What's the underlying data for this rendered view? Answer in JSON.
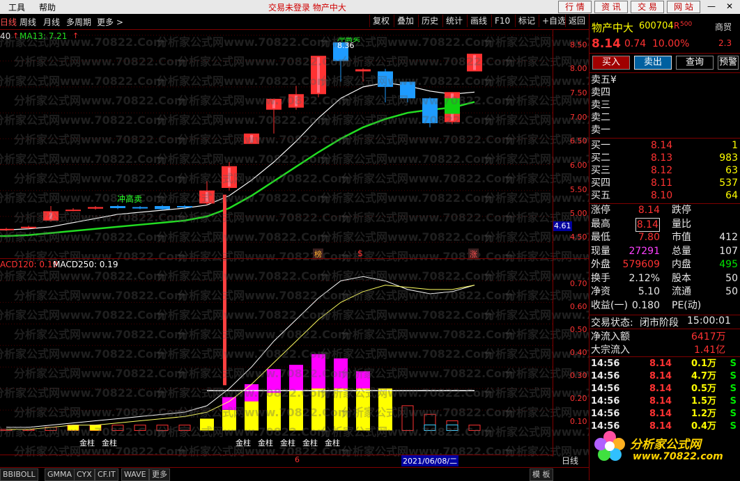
{
  "menu": {
    "tools": "工具",
    "help": "帮助",
    "status": "交易未登录  物产中大",
    "right_buttons": [
      "行  情",
      "资  讯",
      "交  易",
      "网  站"
    ],
    "minimize": "—",
    "close": "✕"
  },
  "toolbar": {
    "periods": [
      "日线",
      "周线",
      "月线",
      "多周期",
      "更多 >"
    ],
    "buttons": [
      "复权",
      "叠加",
      "历史",
      "统计",
      "画线",
      "F10",
      "标记",
      "+自选",
      "返回"
    ]
  },
  "main_chart": {
    "ma_legend_left": "40",
    "ma_label": "MA13: 7.21",
    "high_annotation": "8.36",
    "peak_label": "冲高卖",
    "left_label": "冲高卖",
    "price_ticks": [
      "8.50",
      "8.00",
      "7.50",
      "7.00",
      "6.50",
      "6.00",
      "5.50",
      "5.00",
      "4.50"
    ],
    "current_price_tag": "4.61",
    "markers": [
      "榜",
      "$",
      "涨"
    ]
  },
  "macd_chart": {
    "label1": "ACD120: 0.19",
    "label2": "MACD250: 0.19",
    "ticks": [
      "0.70",
      "0.60",
      "0.50",
      "0.40",
      "0.30",
      "0.20",
      "0.10"
    ],
    "bar_label": "金柱",
    "bar_label_b": "金柱",
    "bar_label_c": "金柱",
    "bar_label_d": "金柱",
    "bar_label_e": "金柱",
    "bar_label_f": "金柱",
    "bar_label_g": "金柱",
    "date_tag": "2021/06/08/二",
    "axis_mark": "6"
  },
  "bottom": {
    "tabs": [
      "BBIBOLL",
      "GMMA",
      "CYX",
      "CF.IT",
      "WAVE",
      "更多"
    ],
    "right_tab": "模  板",
    "period_right": "日线"
  },
  "quote": {
    "name": "物产中大",
    "code": "600704",
    "flag": "R",
    "flag_num": "500",
    "sector": "商贸",
    "price": "8.14",
    "change": "0.74",
    "pct": "10.00%",
    "sector_val": "2.3",
    "buttons": [
      "买入",
      "卖出",
      "查询",
      "预警"
    ],
    "sells": [
      {
        "label": "卖五",
        "extra": "¥",
        "price": "",
        "vol": ""
      },
      {
        "label": "卖四",
        "extra": "",
        "price": "",
        "vol": ""
      },
      {
        "label": "卖三",
        "extra": "",
        "price": "",
        "vol": ""
      },
      {
        "label": "卖二",
        "extra": "",
        "price": "",
        "vol": ""
      },
      {
        "label": "卖一",
        "extra": "",
        "price": "",
        "vol": ""
      }
    ],
    "buys": [
      {
        "label": "买一",
        "price": "8.14",
        "vol": "1"
      },
      {
        "label": "买二",
        "price": "8.13",
        "vol": "983"
      },
      {
        "label": "买三",
        "price": "8.12",
        "vol": "63"
      },
      {
        "label": "买四",
        "price": "8.11",
        "vol": "537"
      },
      {
        "label": "买五",
        "price": "8.10",
        "vol": "64"
      }
    ],
    "stats": [
      {
        "l1": "涨停",
        "v1": "8.14",
        "l2": "跌停",
        "v2": "",
        "c1": "red",
        "c2": "green"
      },
      {
        "l1": "最高",
        "v1": "8.14",
        "l2": "量比",
        "v2": "",
        "c1": "red",
        "c2": "white"
      },
      {
        "l1": "最低",
        "v1": "7.80",
        "l2": "市值",
        "v2": "412",
        "c1": "red",
        "c2": "white"
      },
      {
        "l1": "现量",
        "v1": "27291",
        "l2": "总量",
        "v2": "107",
        "c1": "magenta",
        "c2": "white"
      },
      {
        "l1": "外盘",
        "v1": "579609",
        "l2": "内盘",
        "v2": "495",
        "c1": "red",
        "c2": "green"
      },
      {
        "l1": "换手",
        "v1": "2.12%",
        "l2": "股本",
        "v2": "50",
        "c1": "white",
        "c2": "white"
      },
      {
        "l1": "净资",
        "v1": "5.10",
        "l2": "流通",
        "v2": "50",
        "c1": "white",
        "c2": "white"
      },
      {
        "l1": "收益(一)",
        "v1": "0.180",
        "l2": "PE(动)",
        "v2": "",
        "c1": "white",
        "c2": "white"
      }
    ],
    "trade_status_label": "交易状态:",
    "trade_status": "闭市阶段",
    "trade_time": "15:00:01",
    "net_inflow_label": "净流入额",
    "net_inflow": "6417万",
    "block_inflow_label": "大宗流入",
    "block_inflow": "1.41亿",
    "ticks": [
      {
        "t": "14:56",
        "p": "8.14",
        "v": "0.1万",
        "s": "S"
      },
      {
        "t": "14:56",
        "p": "8.14",
        "v": "4.7万",
        "s": "S"
      },
      {
        "t": "14:56",
        "p": "8.14",
        "v": "0.5万",
        "s": "S"
      },
      {
        "t": "14:56",
        "p": "8.14",
        "v": "1.5万",
        "s": "S"
      },
      {
        "t": "14:56",
        "p": "8.14",
        "v": "1.2万",
        "s": "S"
      },
      {
        "t": "14:56",
        "p": "8.14",
        "v": "0.4万",
        "s": "S"
      }
    ],
    "logo_text": "分析家公式网",
    "logo_url": "www.70822.com"
  },
  "watermark": "分析家公式网www.70822.Com",
  "colors": {
    "up": "#ff3232",
    "down": "#1e9bff",
    "ma_short": "#ffffff",
    "ma_long": "#22dd22",
    "macd_pos": "#ff00ff",
    "macd_yellow": "#ffff00"
  },
  "chart_data": {
    "type": "candlestick",
    "candles": [
      {
        "o": 4.74,
        "c": 4.76,
        "h": 4.78,
        "l": 4.72
      },
      {
        "o": 4.78,
        "c": 4.8,
        "h": 4.82,
        "l": 4.76
      },
      {
        "o": 4.92,
        "c": 5.1,
        "h": 5.2,
        "l": 4.9
      },
      {
        "o": 5.12,
        "c": 5.13,
        "h": 5.16,
        "l": 5.1
      },
      {
        "o": 5.15,
        "c": 5.18,
        "h": 5.2,
        "l": 5.13
      },
      {
        "o": 5.2,
        "c": 5.16,
        "h": 5.22,
        "l": 5.14
      },
      {
        "o": 5.18,
        "c": 5.16,
        "h": 5.2,
        "l": 5.14
      },
      {
        "o": 5.2,
        "c": 5.14,
        "h": 5.22,
        "l": 5.12
      },
      {
        "o": 5.2,
        "c": 5.18,
        "h": 5.22,
        "l": 5.14
      },
      {
        "o": 5.25,
        "c": 5.5,
        "h": 5.68,
        "l": 5.22
      },
      {
        "o": 5.55,
        "c": 5.97,
        "h": 6.05,
        "l": 5.5
      },
      {
        "o": 6.4,
        "c": 6.6,
        "h": 6.6,
        "l": 6.4
      },
      {
        "o": 7.06,
        "c": 7.27,
        "h": 7.27,
        "l": 6.6
      },
      {
        "o": 7.1,
        "c": 7.36,
        "h": 7.52,
        "l": 7.06
      },
      {
        "o": 7.36,
        "c": 8.1,
        "h": 8.1,
        "l": 7.3
      },
      {
        "o": 8.36,
        "c": 8.0,
        "h": 8.36,
        "l": 7.6
      },
      {
        "o": 7.8,
        "c": 7.84,
        "h": 7.86,
        "l": 7.6
      },
      {
        "o": 7.8,
        "c": 7.5,
        "h": 7.85,
        "l": 7.2
      },
      {
        "o": 7.6,
        "c": 7.28,
        "h": 7.6,
        "l": 7.2
      },
      {
        "o": 7.28,
        "c": 6.8,
        "h": 7.3,
        "l": 6.72
      },
      {
        "o": 6.82,
        "c": 7.4,
        "h": 7.4,
        "l": 6.78
      },
      {
        "o": 7.8,
        "c": 8.14,
        "h": 8.14,
        "l": 7.8
      }
    ],
    "ma_short": [
      4.74,
      4.76,
      4.8,
      4.88,
      4.96,
      5.04,
      5.08,
      5.12,
      5.16,
      5.22,
      5.4,
      5.7,
      6.05,
      6.45,
      6.9,
      7.28,
      7.5,
      7.58,
      7.52,
      7.42,
      7.36,
      7.4
    ],
    "ma_long": [
      4.62,
      4.64,
      4.68,
      4.72,
      4.76,
      4.8,
      4.84,
      4.88,
      4.92,
      5.0,
      5.16,
      5.4,
      5.68,
      5.96,
      6.24,
      6.5,
      6.72,
      6.88,
      7.0,
      7.06,
      7.1,
      7.21
    ],
    "ylim": [
      4.3,
      8.6
    ],
    "macd_bars": [
      0.01,
      0.01,
      0.02,
      0.03,
      0.03,
      0.03,
      0.03,
      0.03,
      0.03,
      0.06,
      0.16,
      0.22,
      0.29,
      0.31,
      0.36,
      0.34,
      0.28,
      0.2,
      0.12,
      0.08,
      0.05,
      0.03
    ],
    "macd_yellow": [
      0.02,
      0.02,
      0.03,
      0.04,
      0.04,
      0.04,
      0.04,
      0.04,
      0.04,
      0.06,
      0.1,
      0.14,
      0.18,
      0.19,
      0.2,
      0.2,
      0.2,
      0.2,
      0.18,
      0.16,
      0.14,
      0.18
    ],
    "macd_line1": [
      0.02,
      0.02,
      0.03,
      0.04,
      0.05,
      0.06,
      0.07,
      0.08,
      0.09,
      0.12,
      0.2,
      0.3,
      0.42,
      0.52,
      0.62,
      0.7,
      0.72,
      0.7,
      0.66,
      0.64,
      0.65,
      0.68
    ],
    "macd_line2": [
      0.01,
      0.01,
      0.02,
      0.03,
      0.03,
      0.04,
      0.05,
      0.06,
      0.07,
      0.09,
      0.14,
      0.22,
      0.32,
      0.42,
      0.52,
      0.6,
      0.65,
      0.68,
      0.67,
      0.66,
      0.66,
      0.68
    ],
    "macd_ylim": [
      0.0,
      0.75
    ]
  }
}
